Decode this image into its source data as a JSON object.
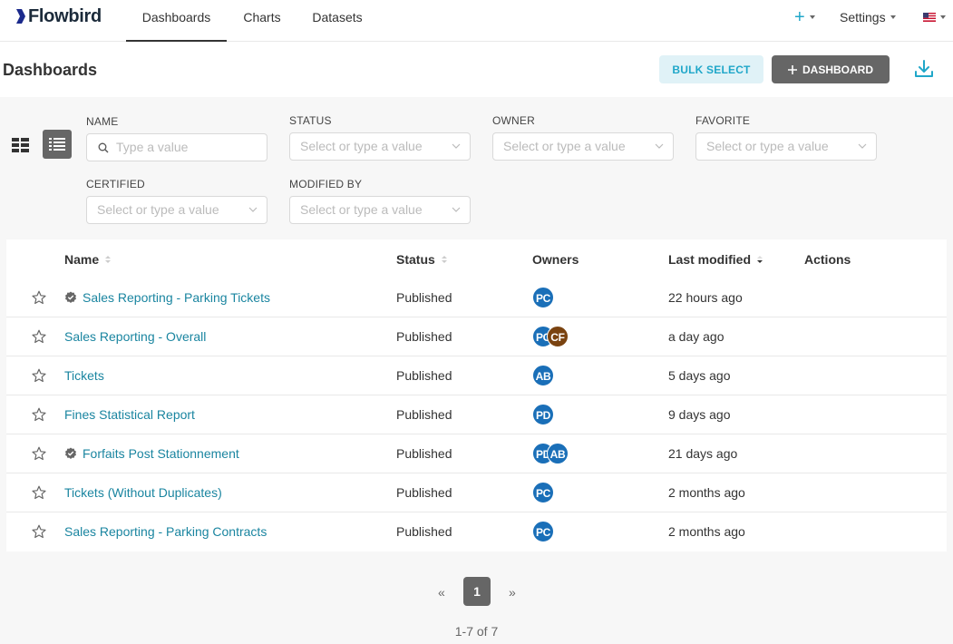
{
  "app": {
    "name": "Flowbird"
  },
  "nav": {
    "tabs": [
      "Dashboards",
      "Charts",
      "Datasets"
    ],
    "active_tab": "Dashboards",
    "plus_label": "+",
    "settings_label": "Settings"
  },
  "header": {
    "title": "Dashboards",
    "bulk_select_label": "BULK SELECT",
    "add_dashboard_label": "DASHBOARD"
  },
  "filters": {
    "name": {
      "label": "NAME",
      "placeholder": "Type a value"
    },
    "status": {
      "label": "STATUS",
      "placeholder": "Select or type a value"
    },
    "owner": {
      "label": "OWNER",
      "placeholder": "Select or type a value"
    },
    "favorite": {
      "label": "FAVORITE",
      "placeholder": "Select or type a value"
    },
    "certified": {
      "label": "CERTIFIED",
      "placeholder": "Select or type a value"
    },
    "modified_by": {
      "label": "MODIFIED BY",
      "placeholder": "Select or type a value"
    }
  },
  "table": {
    "columns": {
      "name": "Name",
      "status": "Status",
      "owners": "Owners",
      "last_modified": "Last modified",
      "actions": "Actions"
    },
    "rows": [
      {
        "name": "Sales Reporting - Parking Tickets",
        "certified": true,
        "status": "Published",
        "owners": [
          {
            "initials": "PC",
            "color": "#1a6fb8"
          }
        ],
        "modified": "22 hours ago"
      },
      {
        "name": "Sales Reporting - Overall",
        "certified": false,
        "status": "Published",
        "owners": [
          {
            "initials": "PC",
            "color": "#1a6fb8"
          },
          {
            "initials": "CF",
            "color": "#7a4310"
          }
        ],
        "modified": "a day ago"
      },
      {
        "name": "Tickets",
        "certified": false,
        "status": "Published",
        "owners": [
          {
            "initials": "AB",
            "color": "#1a6fb8"
          }
        ],
        "modified": "5 days ago"
      },
      {
        "name": "Fines Statistical Report",
        "certified": false,
        "status": "Published",
        "owners": [
          {
            "initials": "PD",
            "color": "#1a6fb8"
          }
        ],
        "modified": "9 days ago"
      },
      {
        "name": "Forfaits Post Stationnement",
        "certified": true,
        "status": "Published",
        "owners": [
          {
            "initials": "PD",
            "color": "#1a6fb8"
          },
          {
            "initials": "AB",
            "color": "#1a6fb8"
          }
        ],
        "modified": "21 days ago"
      },
      {
        "name": "Tickets (Without Duplicates)",
        "certified": false,
        "status": "Published",
        "owners": [
          {
            "initials": "PC",
            "color": "#1a6fb8"
          }
        ],
        "modified": "2 months ago"
      },
      {
        "name": "Sales Reporting - Parking Contracts",
        "certified": false,
        "status": "Published",
        "owners": [
          {
            "initials": "PC",
            "color": "#1a6fb8"
          }
        ],
        "modified": "2 months ago"
      }
    ]
  },
  "pagination": {
    "prev": "«",
    "current": "1",
    "next": "»",
    "summary": "1-7 of 7"
  },
  "icons": {
    "plus": "plus-icon",
    "download": "download-icon",
    "card_view": "card-view-icon",
    "list_view": "list-view-icon",
    "search": "search-icon",
    "star": "star-icon",
    "certified": "certified-icon",
    "flag": "us-flag-icon"
  },
  "colors": {
    "accent": "#20a7c9",
    "link": "#1a85a0",
    "dark_button": "#666666",
    "avatar_blue": "#1a6fb8",
    "avatar_brown": "#7a4310"
  }
}
